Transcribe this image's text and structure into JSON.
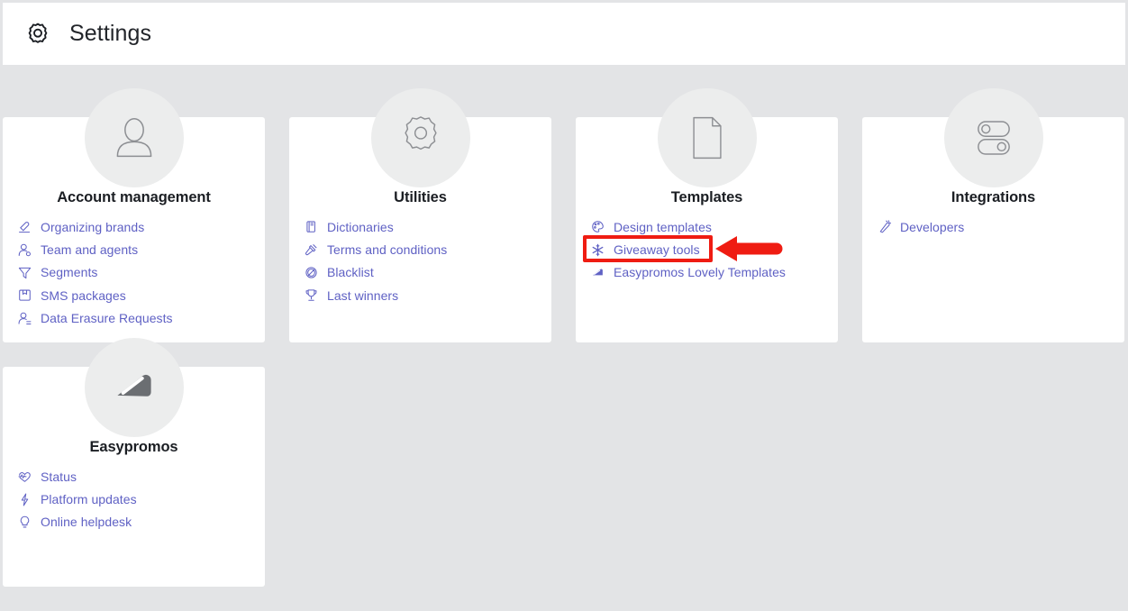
{
  "header": {
    "icon": "gear-icon",
    "title": "Settings"
  },
  "colors": {
    "page_background": "#e3e4e6",
    "card_background": "#ffffff",
    "avatar_background": "#eceded",
    "link_text": "#5f61c4",
    "title_text": "#1b1e23",
    "annotation": "#ef1c12",
    "logo_gray": "#6b6e72"
  },
  "cards": [
    {
      "id": "account-management",
      "title": "Account management",
      "avatar_icon": "user-avatar-icon",
      "links": [
        {
          "label": "Organizing brands",
          "icon": "stamp-icon"
        },
        {
          "label": "Team and agents",
          "icon": "user-settings-icon"
        },
        {
          "label": "Segments",
          "icon": "funnel-filter-icon"
        },
        {
          "label": "SMS packages",
          "icon": "package-box-icon"
        },
        {
          "label": "Data Erasure Requests",
          "icon": "user-erase-icon"
        }
      ]
    },
    {
      "id": "utilities",
      "title": "Utilities",
      "avatar_icon": "gear-icon",
      "links": [
        {
          "label": "Dictionaries",
          "icon": "book-icon"
        },
        {
          "label": "Terms and conditions",
          "icon": "gavel-icon"
        },
        {
          "label": "Blacklist",
          "icon": "block-icon"
        },
        {
          "label": "Last winners",
          "icon": "trophy-icon"
        }
      ]
    },
    {
      "id": "templates",
      "title": "Templates",
      "avatar_icon": "document-page-icon",
      "links": [
        {
          "label": "Design templates",
          "icon": "palette-icon"
        },
        {
          "label": "Giveaway tools",
          "icon": "asterisk-sparkle-icon",
          "highlighted": true
        },
        {
          "label": "Easypromos Lovely Templates",
          "icon": "easypromos-wing-icon"
        }
      ]
    },
    {
      "id": "integrations",
      "title": "Integrations",
      "avatar_icon": "toggle-switches-icon",
      "links": [
        {
          "label": "Developers",
          "icon": "pen-code-icon"
        }
      ]
    },
    {
      "id": "easypromos",
      "title": "Easypromos",
      "avatar_icon": "easypromos-logo-icon",
      "links": [
        {
          "label": "Status",
          "icon": "heartbeat-icon"
        },
        {
          "label": "Platform updates",
          "icon": "lightning-bolt-icon"
        },
        {
          "label": "Online helpdesk",
          "icon": "lightbulb-icon"
        }
      ]
    }
  ],
  "annotation": {
    "highlight_target": "Giveaway tools",
    "shape": "red-rectangle-with-left-arrow",
    "color": "#ef1c12"
  }
}
